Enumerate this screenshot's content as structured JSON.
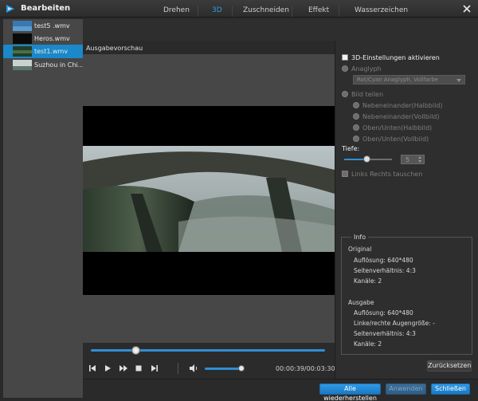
{
  "window": {
    "title": "Bearbeiten"
  },
  "files": [
    {
      "name": "test5 .wmv",
      "selected": false
    },
    {
      "name": "Heros.wmv",
      "selected": false
    },
    {
      "name": "test1.wmv",
      "selected": true
    },
    {
      "name": "Suzhou in Chi...",
      "selected": false
    }
  ],
  "tabs": [
    {
      "label": "Drehen",
      "active": false
    },
    {
      "label": "3D",
      "active": true
    },
    {
      "label": "Zuschneiden",
      "active": false
    },
    {
      "label": "Effekt",
      "active": false
    },
    {
      "label": "Wasserzeichen",
      "active": false
    }
  ],
  "preview": {
    "label": "Ausgabevorschau",
    "time": "00:00:39/00:03:30",
    "seek_fraction": 0.19,
    "volume_fraction": 0.88
  },
  "settings3d": {
    "enable_label": "3D-Einstellungen aktivieren",
    "anaglyph_label": "Anaglyph",
    "anaglyph_select_value": "Rot/Cyan Anaglyph, Vollfarbe",
    "split_label": "Bild teilen",
    "split_options": [
      "Nebeneinander(Halbbild)",
      "Nebeneinander(Vollbild)",
      "Oben/Unten(Halbbild)",
      "Oben/Unten(Vollbild)"
    ],
    "depth_label": "Tiefe:",
    "depth_value": "5",
    "swap_label": "Links Rechts tauschen"
  },
  "info": {
    "title": "Info",
    "original_heading": "Original",
    "original_resolution": "Auflösung: 640*480",
    "original_aspect": "Seitenverhältnis: 4:3",
    "original_channels": "Kanäle: 2",
    "output_heading": "Ausgabe",
    "output_resolution": "Auflösung: 640*480",
    "output_eye_size": "Linke/rechte Augengröße: -",
    "output_aspect": "Seitenverhältnis: 4:3",
    "output_channels": "Kanäle: 2"
  },
  "buttons": {
    "reset": "Zurücksetzen",
    "restore_all": "Alle wiederherstellen",
    "apply": "Anwenden",
    "close": "Schließen"
  },
  "colors": {
    "accent": "#1a88c9",
    "background": "#2a2a2a",
    "panel": "#474747"
  }
}
